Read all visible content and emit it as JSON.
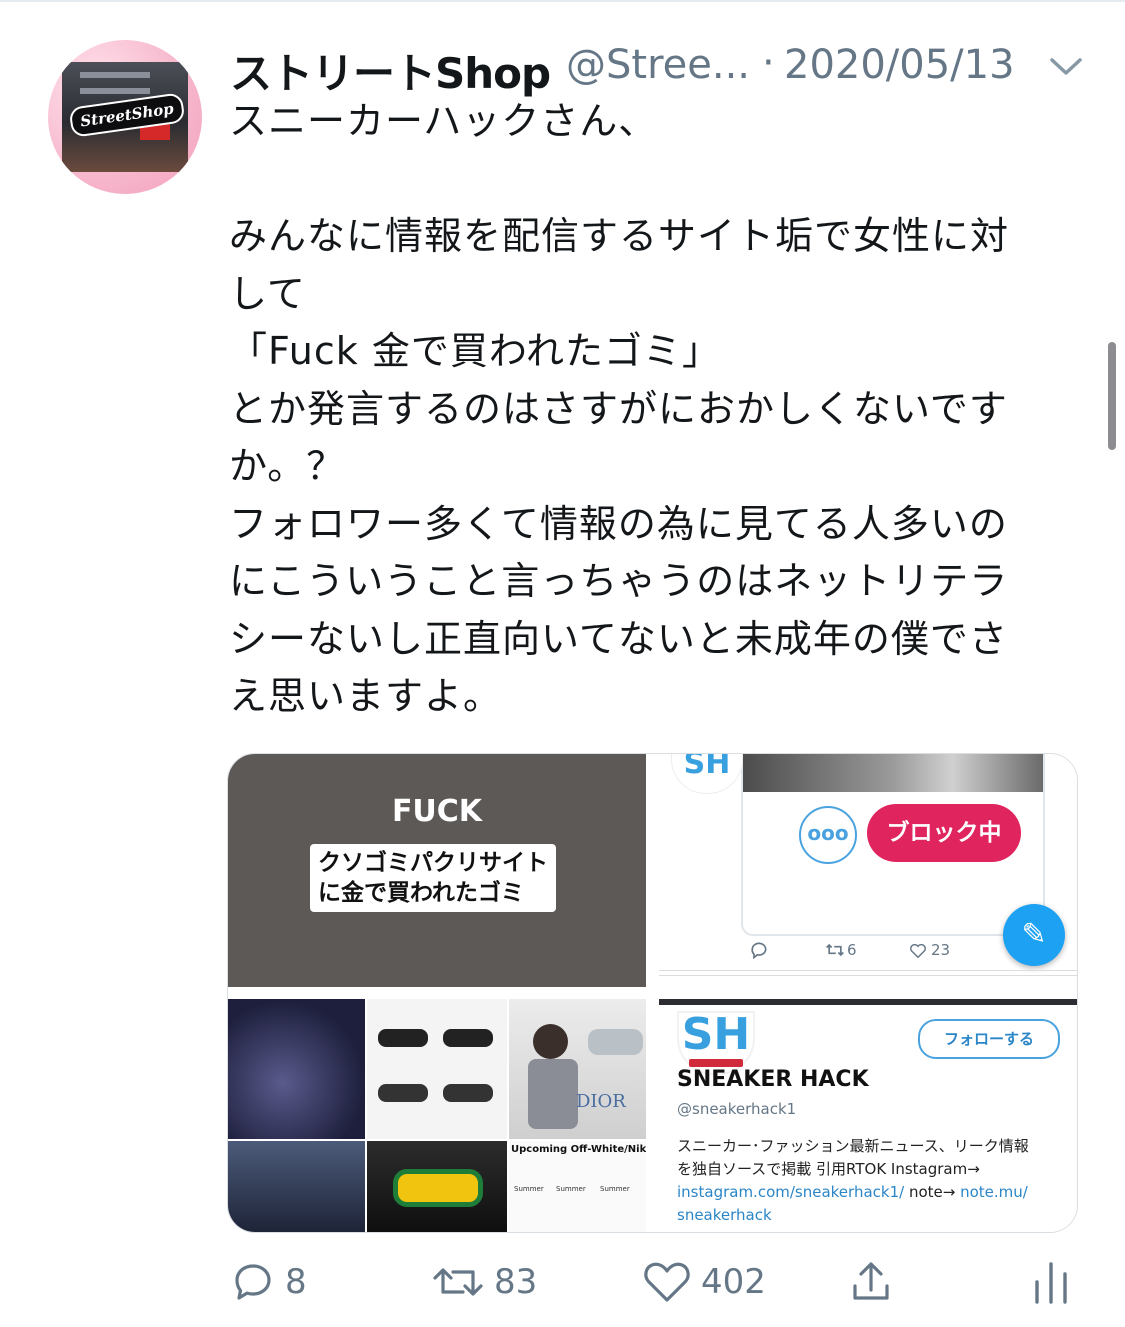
{
  "tweet": {
    "author_name": "ストリートShop",
    "author_handle": "@Stree...",
    "separator": "·",
    "date": "2020/05/13",
    "avatar_logo_text": "StreetShop",
    "text_lines": [
      "スニーカーハックさん、",
      "",
      "みんなに情報を配信するサイト垢で女性に対",
      "して",
      "「Fuck  金で買われたゴミ」",
      "とか発言するのはさすがにおかしくないです",
      "か。？",
      "フォロワー多くて情報の為に見てる人多いの",
      "にこういうこと言っちゃうのはネットリテラ",
      "シーないし正直向いてないと未成年の僕でさ",
      "え思いますよ。"
    ]
  },
  "media": {
    "image1": {
      "headline": "FUCK",
      "caption_lines": [
        "クソゴミパクリサイト",
        "に金で買われたゴミ"
      ]
    },
    "image2": {
      "mini_logo": "SH",
      "more_label": "ooo",
      "blocked_label": "ブロック中",
      "retweets": "6",
      "likes": "23"
    },
    "image3": {
      "item_banner": "Upcoming Off-White/Nike",
      "item_labels": [
        "Summer",
        "Summer",
        "Summer"
      ],
      "brand_text": "DIOR"
    },
    "image4": {
      "logo": "SH",
      "follow_label": "フォローする",
      "profile_name": "SNEAKER HACK",
      "profile_handle": "@sneakerhack1",
      "bio_line1": "スニーカー･ファッション最新ニュース、リーク情報",
      "bio_line2": "を独自ソースで掲載 引用RTOK Instagram→",
      "bio_link1": "instagram.com/sneakerhack1/",
      "bio_note": " note→ ",
      "bio_link2": "note.mu/",
      "bio_link3": "sneakerhack"
    }
  },
  "actions": {
    "replies": "8",
    "retweets": "83",
    "likes": "402"
  },
  "icons": [
    "chevron-down-icon",
    "reply-icon",
    "retweet-icon",
    "like-icon",
    "share-icon",
    "analytics-icon",
    "compose-icon"
  ],
  "colors": {
    "text": "#14171a",
    "secondary": "#657786",
    "accent": "#1da1f2",
    "blocked": "#e0245e"
  }
}
